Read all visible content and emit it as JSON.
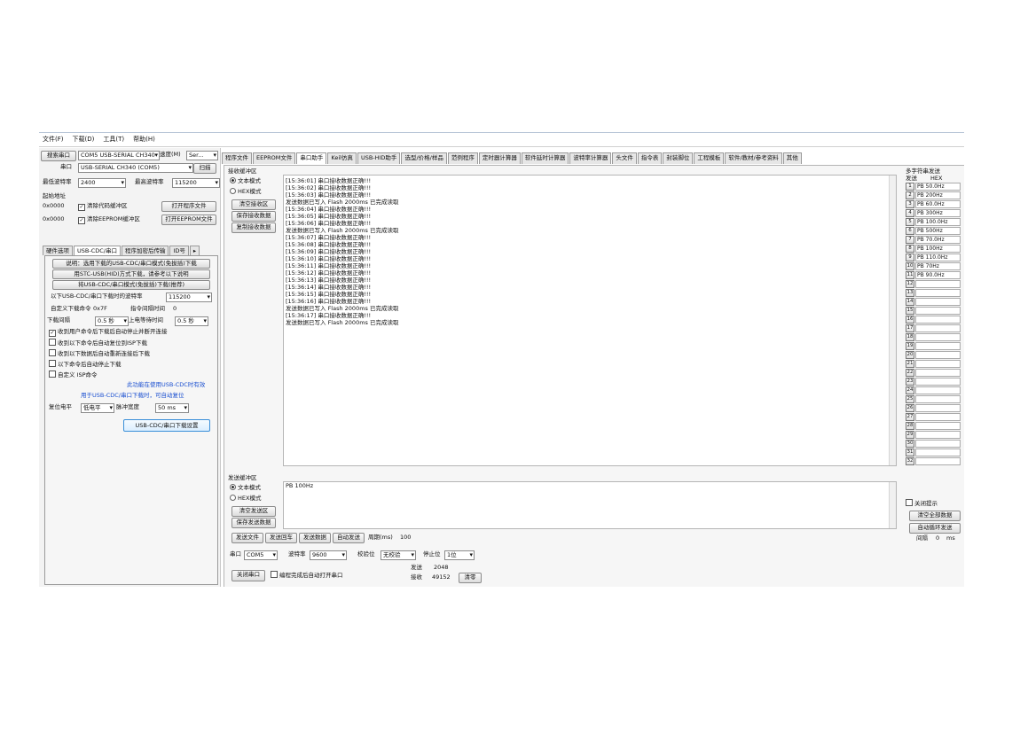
{
  "menu": [
    "文件(F)",
    "下载(D)",
    "工具(T)",
    "帮助(H)"
  ],
  "left": {
    "search_button": "搜索串口",
    "port_model": "COM5 USB-SERIAL CH340",
    "speed_label": "速度(M)",
    "speed_value": "Ser...",
    "port_label": "串口",
    "port_value": "USB-SERIAL CH340 (COM5)",
    "scan_button": "扫描",
    "min_baud_label": "最低波特率",
    "min_baud_value": "2400",
    "max_baud_label": "最高波特率",
    "max_baud_value": "115200",
    "start_addr_label": "起始地址",
    "addr1": "0x0000",
    "addr2": "0x0000",
    "chk_clear_code": "清除代码缓冲区",
    "chk_clear_eeprom": "清除EEPROM缓冲区",
    "open_prog_button": "打开程序文件",
    "open_eeprom_button": "打开EEPROM文件",
    "tabs": [
      "硬件选项",
      "USB-CDC/串口",
      "程序加密后传输",
      "ID号",
      "▸"
    ],
    "panel": {
      "btn1": "说明：选用下载的USB-CDC/串口模式(免拔插)下载",
      "btn2": "用STC-USB(HID)方式下载，请参考以下说明",
      "btn3": "将USB-CDC/串口模式(免拔插)下载(推荐)",
      "baud_label": "以下USB-CDC/串口下载时的波特率",
      "baud_value": "115200",
      "cmd_label": "自定义下载命令",
      "cmd_value": "0x7F",
      "delay_label": "指令间隔时间",
      "delay_value": "0",
      "intv_label": "下载间隔",
      "intv_value": "0.5 秒",
      "wait_label": "上电等待时间",
      "wait_value": "0.5 秒",
      "chk1": "收到用户命令后下载后自动停止并断开连接",
      "chk2": "收到以下命令后自动复位到ISP下载",
      "chk3": "收到以下数据后自动重新连接后下载",
      "chk4": "以下命令后自动停止下载",
      "chk5": "自定义 ISP命令",
      "info1": "此功能在使用USB-CDC时有效",
      "info2": "用于USB-CDC/串口下载时，可自动复位",
      "level_label": "复位电平",
      "level_value": "低电平",
      "pulse_label": "脉冲宽度",
      "pulse_value": "50 ms",
      "apply_button": "USB-CDC/串口下载设置"
    }
  },
  "main_tabs": [
    "程序文件",
    "EEPROM文件",
    "串口助手",
    "Keil仿真",
    "USB-HID助手",
    "选型/价格/样品",
    "范例程序",
    "定时器计算器",
    "软件延时计算器",
    "波特率计算器",
    "头文件",
    "指令表",
    "封装脚位",
    "工程模板",
    "软件/教材/参考资料",
    "其他"
  ],
  "rx": {
    "label": "接收缓冲区",
    "mode_text": "文本模式",
    "mode_hex": "HEX模式",
    "clear_button": "清空接收区",
    "save_button": "保存接收数据",
    "copy_button": "复制接收数据",
    "lines": [
      "[15:36:01] 串口接收数据正确!!!",
      "",
      "[15:36:02] 串口接收数据正确!!!",
      "",
      "[15:36:03] 串口接收数据正确!!!",
      "发送数据已写入 Flash 2000ms 已完成读取",
      "",
      "[15:36:04] 串口接收数据正确!!!",
      "",
      "[15:36:05] 串口接收数据正确!!!",
      "",
      "[15:36:06] 串口接收数据正确!!!",
      "发送数据已写入 Flash 2000ms 已完成读取",
      "",
      "[15:36:07] 串口接收数据正确!!!",
      "",
      "[15:36:08] 串口接收数据正确!!!",
      "",
      "[15:36:09] 串口接收数据正确!!!",
      "",
      "[15:36:10] 串口接收数据正确!!!",
      "",
      "[15:36:11] 串口接收数据正确!!!",
      "",
      "[15:36:12] 串口接收数据正确!!!",
      "",
      "[15:36:13] 串口接收数据正确!!!",
      "",
      "[15:36:14] 串口接收数据正确!!!",
      "",
      "[15:36:15] 串口接收数据正确!!!",
      "",
      "[15:36:16] 串口接收数据正确!!!",
      "发送数据已写入 Flash 2000ms 已完成读取",
      "",
      "[15:36:17] 串口接收数据正确!!!",
      "发送数据已写入 Flash 2000ms 已完成读取"
    ]
  },
  "tx": {
    "label": "发送缓冲区",
    "mode_text": "文本模式",
    "mode_hex": "HEX模式",
    "content": "PB 100Hz",
    "clear_button": "清空发送区",
    "save_button": "保存发送数据",
    "send_file": "发送文件",
    "send_enter": "发送回车",
    "send_data": "发送数据",
    "auto_send": "自动发送",
    "period_label": "周期(ms)",
    "period_value": "100"
  },
  "serial": {
    "port_label": "串口",
    "port_value": "COM5",
    "baud_label": "波特率",
    "baud_value": "9600",
    "parity_label": "校验位",
    "parity_value": "无校验",
    "stop_label": "停止位",
    "stop_value": "1位",
    "close_button": "关闭串口",
    "auto_open": "编程完成后自动打开串口",
    "sent_label": "发送",
    "sent_value": "2048",
    "recv_label": "接收",
    "recv_value": "49152",
    "reset_button": "清零"
  },
  "multi": {
    "title": "多字符串发送",
    "col1": "发送",
    "col2": "HEX",
    "items": [
      {
        "n": "1",
        "t": "PB 50.0Hz"
      },
      {
        "n": "2",
        "t": "PB 200Hz"
      },
      {
        "n": "3",
        "t": "PB 60.0Hz"
      },
      {
        "n": "4",
        "t": "PB 300Hz"
      },
      {
        "n": "5",
        "t": "PB 100.0Hz"
      },
      {
        "n": "6",
        "t": "PB 500Hz"
      },
      {
        "n": "7",
        "t": "PB 70.0Hz"
      },
      {
        "n": "8",
        "t": "PB 100Hz"
      },
      {
        "n": "9",
        "t": "PB 110.0Hz"
      },
      {
        "n": "10",
        "t": "PB 70Hz"
      },
      {
        "n": "11",
        "t": "PB 90.0Hz"
      },
      {
        "n": "12",
        "t": ""
      },
      {
        "n": "13",
        "t": ""
      },
      {
        "n": "14",
        "t": ""
      },
      {
        "n": "15",
        "t": ""
      },
      {
        "n": "16",
        "t": ""
      },
      {
        "n": "17",
        "t": ""
      },
      {
        "n": "18",
        "t": ""
      },
      {
        "n": "19",
        "t": ""
      },
      {
        "n": "20",
        "t": ""
      },
      {
        "n": "21",
        "t": ""
      },
      {
        "n": "22",
        "t": ""
      },
      {
        "n": "23",
        "t": ""
      },
      {
        "n": "24",
        "t": ""
      },
      {
        "n": "25",
        "t": ""
      },
      {
        "n": "26",
        "t": ""
      },
      {
        "n": "27",
        "t": ""
      },
      {
        "n": "28",
        "t": ""
      },
      {
        "n": "29",
        "t": ""
      },
      {
        "n": "30",
        "t": ""
      },
      {
        "n": "31",
        "t": ""
      },
      {
        "n": "32",
        "t": ""
      }
    ],
    "loop_chk": "关闭提示",
    "clear_all": "清空全部数据",
    "auto_loop": "自动循环发送",
    "interval_label": "间隔",
    "interval_value": "0",
    "unit": "ms"
  }
}
